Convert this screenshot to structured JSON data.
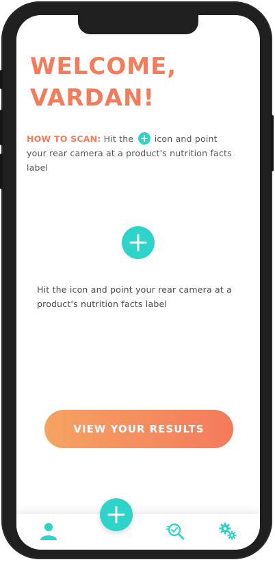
{
  "greeting": {
    "line1": "WELCOME,",
    "line2": "VARDAN!"
  },
  "how_to": {
    "label": "HOW TO SCAN:",
    "before_icon": "Hit the",
    "after_icon": "icon and point your rear camera at a product's nutrition facts label"
  },
  "scan": {
    "icon": "plus-icon",
    "help_text": "Hit the icon and point your rear camera at a product's nutrition facts label"
  },
  "results_button": {
    "label": "VIEW YOUR RESULTS"
  },
  "tabbar": {
    "items": [
      {
        "icon": "user-icon"
      },
      {
        "icon": "plus-icon"
      },
      {
        "icon": "search-results-icon"
      },
      {
        "icon": "gears-icon"
      }
    ]
  },
  "colors": {
    "accent_orange": "#f47c5a",
    "accent_teal": "#2ed3c9",
    "gradient_start": "#f6a363",
    "gradient_end": "#f47a5c"
  }
}
